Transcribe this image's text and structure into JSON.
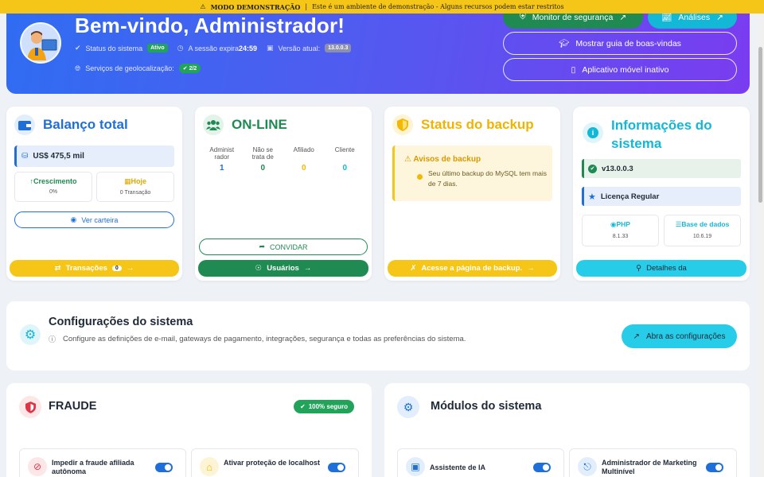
{
  "demo": {
    "label": "MODO DEMONSTRAÇÃO",
    "separator": "|",
    "text": "Este é um ambiente de demonstração - Alguns recursos podem estar restritos"
  },
  "hero": {
    "title": "Bem-vindo, Administrador!",
    "status_label": "Status do sistema",
    "status_badge": "Ativo",
    "session_label": "A sessão expira",
    "session_value": "24:59",
    "version_label": "Versão atual:",
    "version_badge": "13.0.0.3",
    "geo_label": "Serviços de geolocalização:",
    "geo_badge": "2/2",
    "btn_security": "Monitor de segurança",
    "btn_analytics": "Análises",
    "btn_guide": "Mostrar guia de boas-vindas",
    "btn_mobile": "Aplicativo móvel inativo"
  },
  "balance": {
    "title": "Balanço total",
    "amount": "US$ 475,5 mil",
    "growth_label": "Crescimento",
    "growth_value": "0%",
    "today_label": "Hoje",
    "today_value": "0 Transação",
    "wallet_btn": "Ver carteira",
    "footer_btn": "Transações",
    "footer_count": "0"
  },
  "online": {
    "title": "ON-LINE",
    "columns": [
      {
        "label": "Administ rador",
        "value": "1",
        "color": "#1e6fd9"
      },
      {
        "label": "Não se trata de",
        "value": "0",
        "color": "#1f8a52"
      },
      {
        "label": "Afiliado",
        "value": "0",
        "color": "#f5b800"
      },
      {
        "label": "Cliente",
        "value": "0",
        "color": "#12b8d6"
      }
    ],
    "invite_btn": "CONVIDAR",
    "footer_btn": "Usuários"
  },
  "backup": {
    "title": "Status do backup",
    "alert_title": "Avisos de backup",
    "alert_text": "Seu último backup do MySQL tem mais de 7 dias.",
    "footer_btn": "Acesse a página de backup."
  },
  "sysinfo": {
    "title": "Informações do sistema",
    "version": "v13.0.0.3",
    "license": "Licença Regular",
    "php_label": "PHP",
    "php_value": "8.1.33",
    "db_label": "Base de dados",
    "db_value": "10.6.19",
    "footer_btn": "Detalhes da"
  },
  "settings": {
    "title": "Configurações do sistema",
    "description": "Configure as definições de e-mail, gateways de pagamento, integrações, segurança e todas as preferências do sistema.",
    "button": "Abra as configurações"
  },
  "fraud": {
    "title": "FRAUDE",
    "badge": "100% seguro",
    "features": [
      "Impedir a fraude afiliada autônoma",
      "Ativar proteção de localhost"
    ]
  },
  "modules": {
    "title": "Módulos do sistema",
    "features": [
      "Assistente de IA",
      "Administrador de Marketing Multinível"
    ]
  },
  "colors": {
    "blue": "#1e6fd9",
    "green": "#1f8a52",
    "yellow": "#f5c518",
    "cyan": "#12b8d6",
    "red": "#dc3545"
  }
}
